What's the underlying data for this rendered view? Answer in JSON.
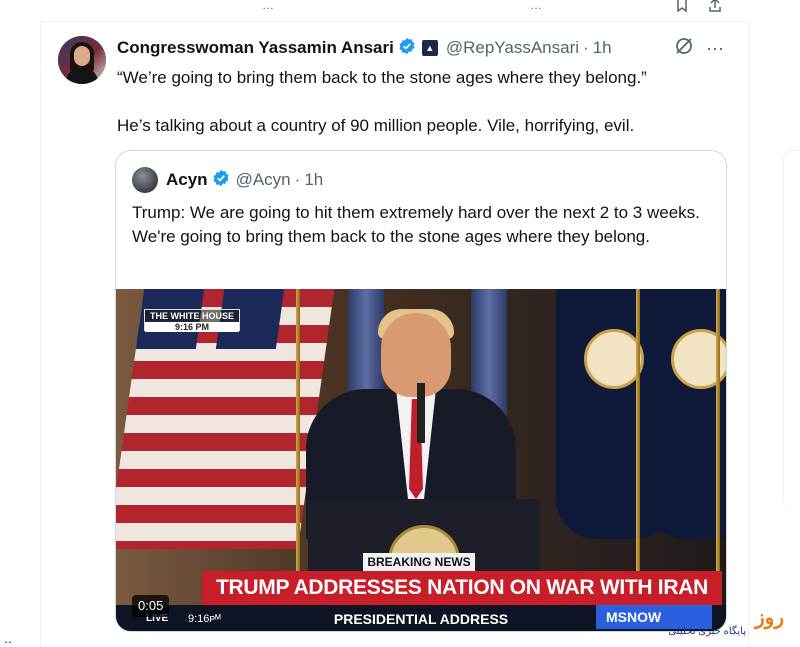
{
  "topbar": {
    "fragment_left": "…",
    "fragment_mid": "…"
  },
  "post": {
    "author_name": "Congresswoman Yassamin Ansari",
    "handle": "@RepYassAnsari",
    "separator": "·",
    "time": "1h",
    "text_lines": [
      "“We’re going to bring them back to the stone ages where they belong.”",
      "He’s talking about a country of 90 million people. Vile, horrifying, evil."
    ]
  },
  "quote": {
    "author_name": "Acyn",
    "handle": "@Acyn",
    "separator": "·",
    "time": "1h",
    "text": "Trump: We are going to hit them extremely hard over the next 2 to 3 weeks. We're going to bring them back to the stone ages where they belong."
  },
  "video": {
    "network_tag_top": "THE WHITE HOUSE",
    "network_tag_time": "9:16 PM",
    "breaking_label": "BREAKING NEWS",
    "headline": "TRUMP ADDRESSES NATION ON WAR WITH IRAN",
    "lower_title": "PRESIDENTIAL ADDRESS",
    "live_label": "LIVE",
    "clock": "9:16ᴘᴹ",
    "channel": "MSNOW",
    "elapsed": "0:05"
  },
  "watermark": {
    "brand": "روز",
    "tagline": "پایگاه خبری تحلیلی"
  },
  "colors": {
    "verified": "#1d9bf0",
    "gov_badge": "#1c2a4a",
    "headline_red": "#c81e2a",
    "msnow_blue": "#2a5fe0"
  }
}
